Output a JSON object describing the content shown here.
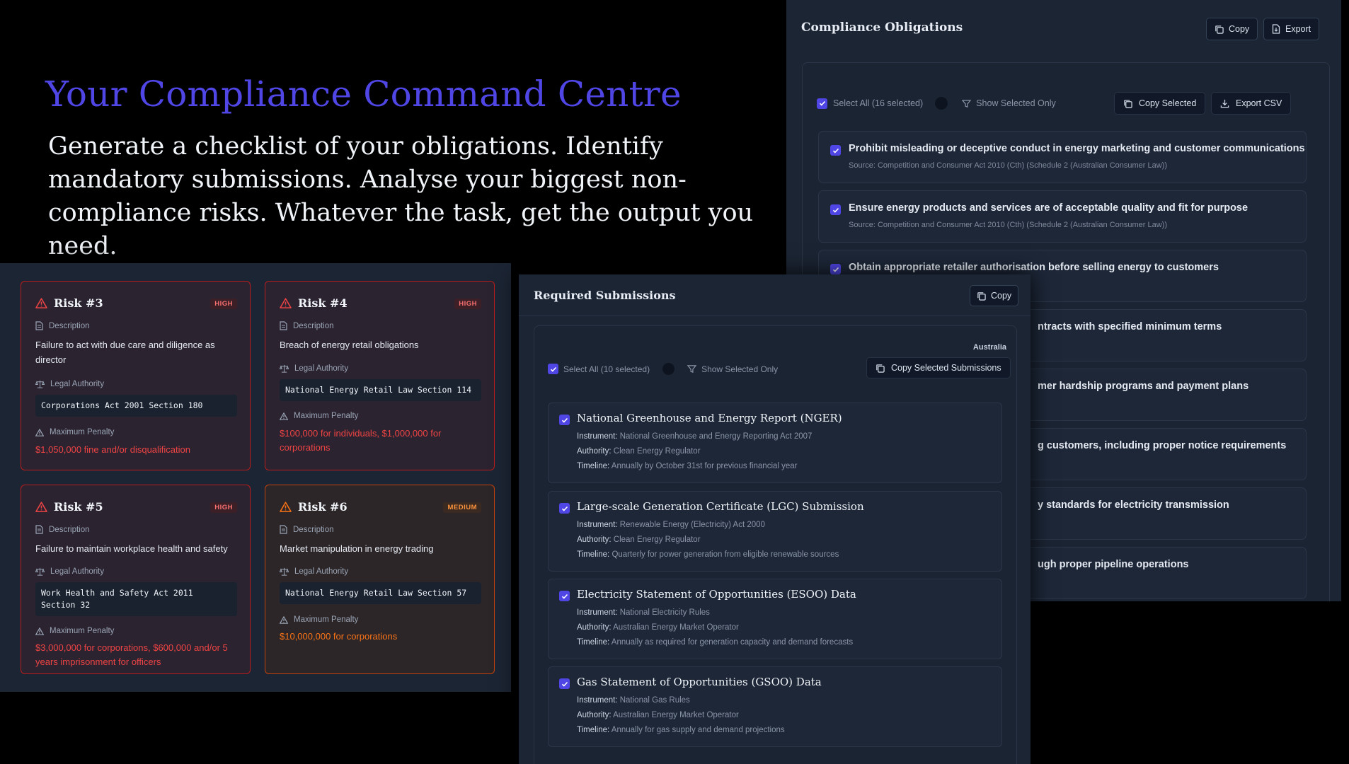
{
  "hero": {
    "title": "Your Compliance Command Centre",
    "subtitle": "Generate a checklist of your obligations. Identify mandatory submissions. Analyse your biggest non-compliance risks. Whatever the task, get the output you need."
  },
  "obligations": {
    "title": "Compliance Obligations",
    "copy_label": "Copy",
    "export_label": "Export",
    "select_all": "Select All (16 selected)",
    "show_selected": "Show Selected Only",
    "copy_selected": "Copy Selected",
    "export_csv": "Export CSV",
    "items": [
      {
        "title": "Prohibit misleading or deceptive conduct in energy marketing and customer communications",
        "source": "Source: Competition and Consumer Act 2010 (Cth) (Schedule 2 (Australian Consumer Law))"
      },
      {
        "title": "Ensure energy products and services are of acceptable quality and fit for purpose",
        "source": "Source: Competition and Consumer Act 2010 (Cth) (Schedule 2 (Australian Consumer Law))"
      },
      {
        "title": "Obtain appropriate retailer authorisation before selling energy to customers",
        "source": ""
      },
      {
        "title": "ntracts with specified minimum terms",
        "source": ""
      },
      {
        "title": "mer hardship programs and payment plans",
        "source": ""
      },
      {
        "title": "g customers, including proper notice requirements",
        "source": ""
      },
      {
        "title": "y standards for electricity transmission",
        "source": ""
      },
      {
        "title": "ugh proper pipeline operations",
        "source": ""
      }
    ]
  },
  "risks": {
    "label_description": "Description",
    "label_authority": "Legal Authority",
    "label_penalty": "Maximum Penalty",
    "items": [
      {
        "title": "Risk #3",
        "badge": "HIGH",
        "description": "Failure to act with due care and diligence as director",
        "authority": "Corporations Act 2001 Section 180",
        "penalty": "$1,050,000 fine and/or disqualification"
      },
      {
        "title": "Risk #4",
        "badge": "HIGH",
        "description": "Breach of energy retail obligations",
        "authority": "National Energy Retail Law Section 114",
        "penalty": "$100,000 for individuals, $1,000,000 for corporations"
      },
      {
        "title": "Risk #5",
        "badge": "HIGH",
        "description": "Failure to maintain workplace health and safety",
        "authority": "Work Health and Safety Act 2011 Section 32",
        "penalty": "$3,000,000 for corporations, $600,000 and/or 5 years imprisonment for officers"
      },
      {
        "title": "Risk #6",
        "badge": "MEDIUM",
        "description": "Market manipulation in energy trading",
        "authority": "National Energy Retail Law Section 57",
        "penalty": "$10,000,000 for corporations"
      }
    ]
  },
  "submissions": {
    "title": "Required Submissions",
    "copy_label": "Copy",
    "country": "Australia",
    "select_all": "Select All (10 selected)",
    "show_selected": "Show Selected Only",
    "copy_selected": "Copy Selected Submissions",
    "label_instrument": "Instrument:",
    "label_authority": "Authority:",
    "label_timeline": "Timeline:",
    "items": [
      {
        "title": "National Greenhouse and Energy Report (NGER)",
        "instrument": "National Greenhouse and Energy Reporting Act 2007",
        "authority": "Clean Energy Regulator",
        "timeline": "Annually by October 31st for previous financial year"
      },
      {
        "title": "Large-scale Generation Certificate (LGC) Submission",
        "instrument": "Renewable Energy (Electricity) Act 2000",
        "authority": "Clean Energy Regulator",
        "timeline": "Quarterly for power generation from eligible renewable sources"
      },
      {
        "title": "Electricity Statement of Opportunities (ESOO) Data",
        "instrument": "National Electricity Rules",
        "authority": "Australian Energy Market Operator",
        "timeline": "Annually as required for generation capacity and demand forecasts"
      },
      {
        "title": "Gas Statement of Opportunities (GSOO) Data",
        "instrument": "National Gas Rules",
        "authority": "Australian Energy Market Operator",
        "timeline": "Annually for gas supply and demand projections"
      }
    ]
  },
  "colors": {
    "accent": "#4f46e5",
    "panel": "#1c2534",
    "high": "#ef4444",
    "medium": "#f97316"
  }
}
